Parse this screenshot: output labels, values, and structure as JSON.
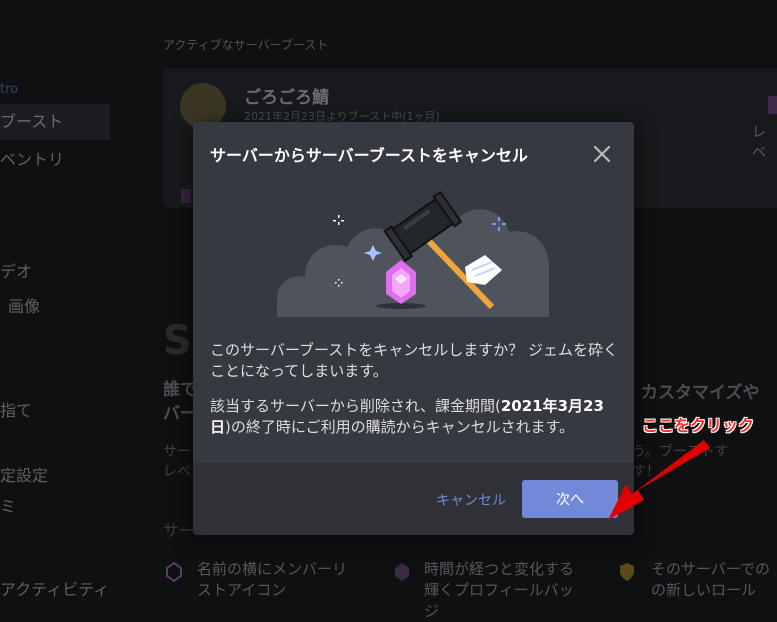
{
  "sidebar": {
    "items": [
      {
        "label": "tro"
      },
      {
        "label": "ブースト"
      },
      {
        "label": "ベントリ"
      },
      {
        "label": "デオ"
      },
      {
        "label": "画像"
      },
      {
        "label": "指て"
      },
      {
        "label": "定設定"
      },
      {
        "label": "ミ"
      },
      {
        "label": "アクティビティ"
      }
    ]
  },
  "background": {
    "section_title": "アクティブなサーバーブースト",
    "server_name": "ごろごろ鯖",
    "boost_since": "2021年2月23日よりブースト中(1ヶ月)",
    "level_text": "レベ",
    "big_letters": "Se",
    "heading_left_1": "誰で",
    "heading_left_2": "バー",
    "heading_right": "カスタマイズや",
    "small_left_1": "サー",
    "small_left_2": "レベ",
    "small_right_1": "ょう。ブーストす",
    "small_right_2": "ます！",
    "subheading": "サー",
    "perks": [
      {
        "line1": "名前の横にメンバーリ",
        "line2": "ストアイコン"
      },
      {
        "line1": "時間が経つと変化する",
        "line2": "輝くプロフィールバッ",
        "line3": "ジ"
      },
      {
        "line1": "そのサーバーでの",
        "line2": "の新しいロール"
      }
    ]
  },
  "modal": {
    "title": "サーバーからサーバーブーストをキャンセル",
    "body_p1": "このサーバーブーストをキャンセルしますか？ ジェムを砕くことになってしまいます。",
    "body_p2_pre": "該当するサーバーから削除され、課金期間(",
    "body_p2_date": "2021年3月23日",
    "body_p2_post": ")の終了時にご利用の購読からキャンセルされます。",
    "cancel_label": "キャンセル",
    "next_label": "次へ"
  },
  "annotation": {
    "callout": "ここをクリック",
    "color": "#ff2a2a"
  },
  "colors": {
    "accent": "#7289da",
    "modal_bg": "#36393f",
    "footer_bg": "#2f3136",
    "gem": "#e06cf0"
  },
  "icons": {
    "close": "close-icon",
    "hammer": "hammer-icon",
    "gem": "gem-icon",
    "sparkle": "sparkle-icon"
  }
}
